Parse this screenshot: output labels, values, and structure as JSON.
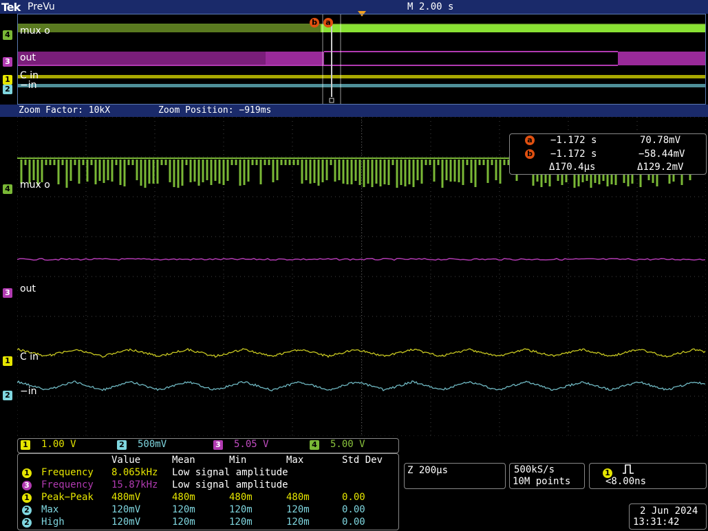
{
  "header": {
    "brand": "Tek",
    "mode": "PreVu",
    "timebase": "M 2.00 s"
  },
  "overview": {
    "channels": [
      {
        "id": "4",
        "label": "mux o"
      },
      {
        "id": "3",
        "label": "out"
      },
      {
        "id": "1",
        "label": "C in"
      },
      {
        "id": "2",
        "label": "−in"
      }
    ],
    "cursor_a": "a",
    "cursor_b": "b"
  },
  "zoom": {
    "factor": "Zoom Factor: 10kX",
    "position": "Zoom Position: −919ms"
  },
  "main_channels": [
    {
      "id": "4",
      "label": "mux o"
    },
    {
      "id": "3",
      "label": "out"
    },
    {
      "id": "1",
      "label": "C in"
    },
    {
      "id": "2",
      "label": "−in"
    }
  ],
  "cursors": {
    "a_time": "−1.172 s",
    "a_value": "70.78mV",
    "b_time": "−1.172 s",
    "b_value": "−58.44mV",
    "delta_time": "Δ170.4µs",
    "delta_value": "Δ129.2mV"
  },
  "scales": [
    {
      "id": "1",
      "value": "1.00 V"
    },
    {
      "id": "2",
      "value": "500mV"
    },
    {
      "id": "3",
      "value": "5.05 V"
    },
    {
      "id": "4",
      "value": "5.00 V"
    }
  ],
  "measurements": {
    "headers": [
      "Value",
      "Mean",
      "Min",
      "Max",
      "Std Dev"
    ],
    "rows": [
      {
        "ch": "1",
        "name": "Frequency",
        "value": "8.065kHz",
        "mean": "Low signal amplitude",
        "min": "",
        "max": "",
        "std": ""
      },
      {
        "ch": "3",
        "name": "Frequency",
        "value": "15.87kHz",
        "mean": "Low signal amplitude",
        "min": "",
        "max": "",
        "std": ""
      },
      {
        "ch": "1",
        "name": "Peak−Peak",
        "value": "480mV",
        "mean": "480m",
        "min": "480m",
        "max": "480m",
        "std": "0.00"
      },
      {
        "ch": "2",
        "name": "Max",
        "value": "120mV",
        "mean": "120m",
        "min": "120m",
        "max": "120m",
        "std": "0.00"
      },
      {
        "ch": "2",
        "name": "High",
        "value": "120mV",
        "mean": "120m",
        "min": "120m",
        "max": "120m",
        "std": "0.00"
      }
    ]
  },
  "horizontal": {
    "zoom_scale": "Z 200µs"
  },
  "acquisition": {
    "rate": "500kS/s",
    "points": "10M points"
  },
  "trigger": {
    "channel": "1",
    "symbol": "⎍",
    "value": "<8.00ns"
  },
  "datetime": {
    "date": "2 Jun 2024",
    "time": "13:31:42"
  },
  "colors": {
    "ch1": "#e6e600",
    "ch2": "#7fd6df",
    "ch3": "#b13ab1",
    "ch4": "#7ab836",
    "frame": "#1a2a6a",
    "cursor": "#e05010"
  }
}
